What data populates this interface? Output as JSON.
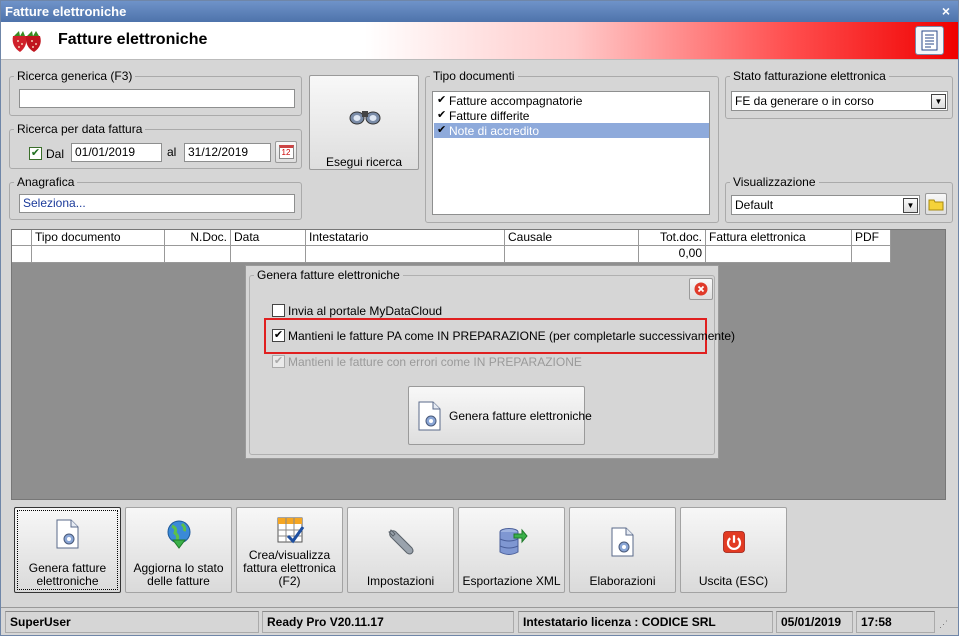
{
  "window": {
    "title": "Fatture elettroniche",
    "close_glyph": "×"
  },
  "header": {
    "title": "Fatture elettroniche"
  },
  "search": {
    "generic_label": "Ricerca generica (F3)",
    "generic_value": "",
    "date_label": "Ricerca per data fattura",
    "dal_label": "Dal",
    "dal_checked": true,
    "from_date": "01/01/2019",
    "al_label": "al",
    "to_date": "31/12/2019",
    "calendar_glyph": "12",
    "anagrafica_label": "Anagrafica",
    "anagrafica_value": "Seleziona...",
    "search_button": "Esegui ricerca"
  },
  "tipo_documenti": {
    "label": "Tipo documenti",
    "items": [
      {
        "label": "Fatture accompagnatorie",
        "checked": true,
        "selected": false
      },
      {
        "label": "Fatture differite",
        "checked": true,
        "selected": false
      },
      {
        "label": "Note di accredito",
        "checked": true,
        "selected": true
      }
    ]
  },
  "stato": {
    "label": "Stato fatturazione elettronica",
    "value": "FE da generare o in corso"
  },
  "visualizzazione": {
    "label": "Visualizzazione",
    "value": "Default"
  },
  "grid": {
    "columns": [
      "Tipo documento",
      "N.Doc.",
      "Data",
      "Intestatario",
      "Causale",
      "Tot.doc.",
      "Fattura elettronica",
      "PDF"
    ],
    "row": [
      "",
      "",
      "",
      "",
      "",
      "0,00",
      "",
      ""
    ]
  },
  "dialog": {
    "title": "Genera fatture elettroniche",
    "options": [
      {
        "label": "Invia al portale MyDataCloud",
        "checked": false,
        "disabled": false
      },
      {
        "label": "Mantieni le fatture PA come IN PREPARAZIONE (per completarle successivamente)",
        "checked": true,
        "disabled": false
      },
      {
        "label": "Mantieni le fatture con errori come IN PREPARAZIONE",
        "checked": true,
        "disabled": true
      }
    ],
    "generate_button": "Genera fatture elettroniche",
    "highlight_color": "#e02020"
  },
  "toolbar": [
    {
      "line1": "Genera fatture",
      "line2": "elettroniche",
      "line3": "",
      "icon": "document-gear-icon"
    },
    {
      "line1": "Aggiorna lo stato",
      "line2": "delle fatture",
      "line3": "",
      "icon": "globe-arrow-icon"
    },
    {
      "line1": "Crea/visualizza",
      "line2": "fattura elettronica",
      "line3": "(F2)",
      "icon": "invoice-check-icon"
    },
    {
      "line1": "Impostazioni",
      "line2": "",
      "line3": "",
      "icon": "wrench-icon"
    },
    {
      "line1": "Esportazione XML",
      "line2": "",
      "line3": "",
      "icon": "database-export-icon"
    },
    {
      "line1": "Elaborazioni",
      "line2": "",
      "line3": "",
      "icon": "document-gear-icon"
    },
    {
      "line1": "Uscita (ESC)",
      "line2": "",
      "line3": "",
      "icon": "power-icon"
    }
  ],
  "status": {
    "user": "SuperUser",
    "version": "Ready Pro V20.11.17",
    "license": "Intestatario licenza : CODICE SRL",
    "date": "05/01/2019",
    "time": "17:58"
  }
}
